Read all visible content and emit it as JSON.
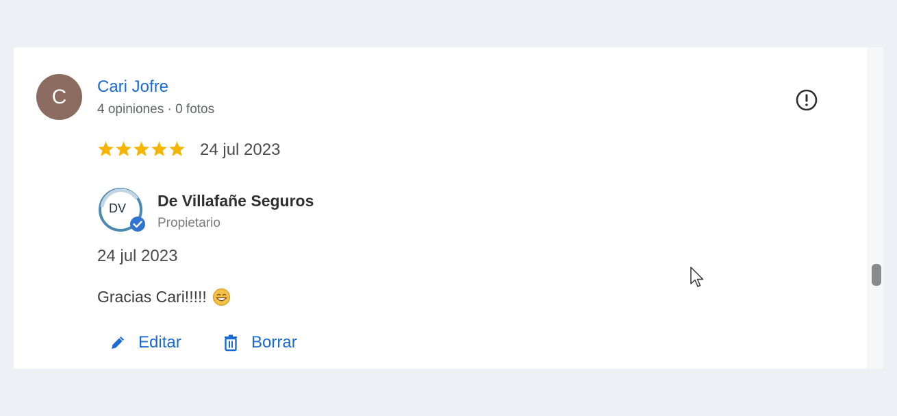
{
  "review": {
    "author": {
      "initial": "C",
      "name": "Cari Jofre",
      "meta": "4 opiniones · 0 fotos",
      "avatar_color": "#8c6b61"
    },
    "rating": 5,
    "rating_max": 5,
    "date": "24 jul 2023",
    "report_icon": "report-flag-icon",
    "star_color": "#f5b400"
  },
  "owner_reply": {
    "logo_text": "DV",
    "logo_icon": "verified-badge-icon",
    "name": "De Villafañe Seguros",
    "role": "Propietario",
    "date": "24 jul 2023",
    "text": "Gracias Cari!!!!!",
    "emoji_icon": "grinning-face-emoji-icon"
  },
  "actions": {
    "edit_label": "Editar",
    "delete_label": "Borrar",
    "edit_icon": "pencil-icon",
    "delete_icon": "trash-icon"
  },
  "colors": {
    "accent": "#1a6ad2",
    "background": "#edf0f4",
    "card": "#ffffff"
  }
}
